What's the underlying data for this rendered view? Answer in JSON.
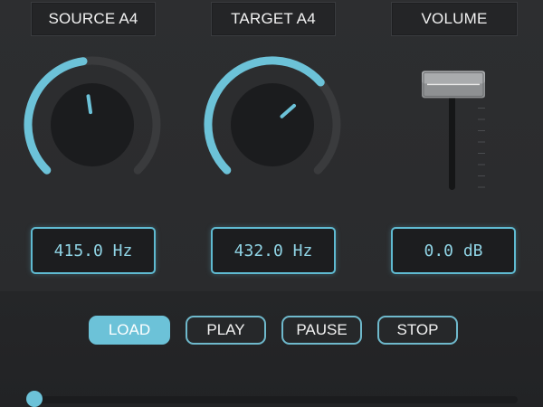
{
  "colors": {
    "accent": "#6cc2d8",
    "background": "#2a2b2d",
    "knob_track": "#3a3b3d",
    "knob_body": "#1b1c1e",
    "readout_text": "#8fd3e4"
  },
  "source": {
    "header": "SOURCE A4",
    "readout": "415.0 Hz",
    "knob_fraction": 0.47
  },
  "target": {
    "header": "TARGET A4",
    "readout": "432.0 Hz",
    "knob_fraction": 0.68
  },
  "volume": {
    "header": "VOLUME",
    "readout": "0.0 dB",
    "fader_fraction": 0.93
  },
  "transport": {
    "load": "LOAD",
    "play": "PLAY",
    "pause": "PAUSE",
    "stop": "STOP",
    "active": "load"
  },
  "seek": {
    "position_fraction": 0.0
  },
  "icons": [
    "knob-dial",
    "fader-handle",
    "seek-thumb"
  ]
}
